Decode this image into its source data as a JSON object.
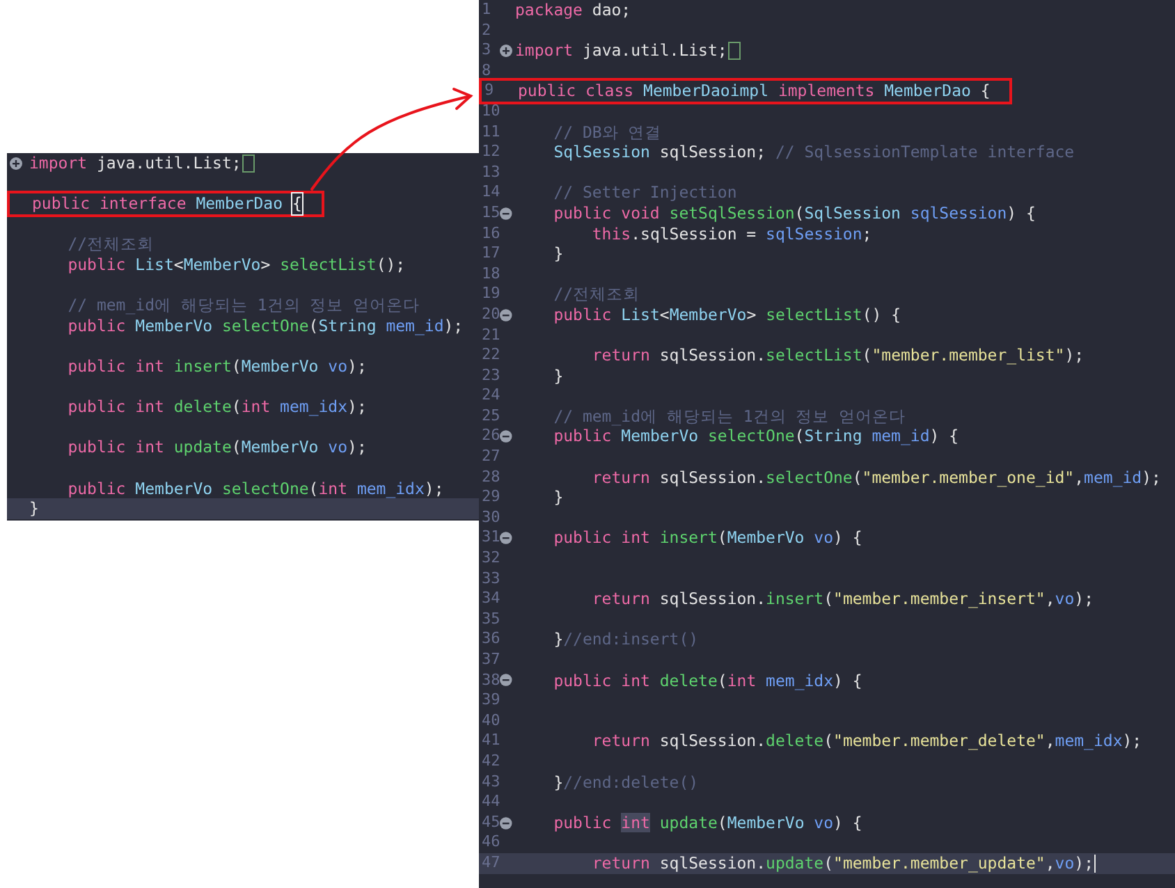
{
  "panels": [
    {
      "kind": "interface",
      "lines": [
        {
          "fold": {
            "collapsed": true
          },
          "framed": false,
          "current": false,
          "tokens": [
            {
              "kind": "keyword",
              "text": "import"
            },
            {
              "kind": "plain",
              "text": " java.util.List;"
            },
            {
              "kind": "folded"
            }
          ]
        },
        {
          "framed": false,
          "current": false
        },
        {
          "framed": true,
          "current": false,
          "tokens": [
            {
              "kind": "keyword",
              "text": "public interface "
            },
            {
              "kind": "type",
              "text": "MemberDao "
            },
            {
              "kind": "matched-bracket",
              "text": "{"
            }
          ]
        },
        {
          "framed": false,
          "current": false
        },
        {
          "framed": false,
          "current": false,
          "tokens": [
            {
              "kind": "comment",
              "text": "    //전체조회"
            }
          ]
        },
        {
          "framed": false,
          "current": false,
          "tokens": [
            {
              "kind": "keyword",
              "text": "    public "
            },
            {
              "kind": "type",
              "text": "List"
            },
            {
              "kind": "plain",
              "text": "<"
            },
            {
              "kind": "type",
              "text": "MemberVo"
            },
            {
              "kind": "plain",
              "text": "> "
            },
            {
              "kind": "method",
              "text": "selectList"
            },
            {
              "kind": "plain",
              "text": "();"
            }
          ]
        },
        {
          "framed": false,
          "current": false
        },
        {
          "framed": false,
          "current": false,
          "tokens": [
            {
              "kind": "comment",
              "text": "    // mem_id에 해당되는 1건의 정보 얻어온다"
            }
          ]
        },
        {
          "framed": false,
          "current": false,
          "tokens": [
            {
              "kind": "keyword",
              "text": "    public "
            },
            {
              "kind": "type",
              "text": "MemberVo "
            },
            {
              "kind": "method",
              "text": "selectOne"
            },
            {
              "kind": "plain",
              "text": "("
            },
            {
              "kind": "type",
              "text": "String "
            },
            {
              "kind": "variable",
              "text": "mem_id"
            },
            {
              "kind": "plain",
              "text": ");"
            }
          ]
        },
        {
          "framed": false,
          "current": false
        },
        {
          "framed": false,
          "current": false,
          "tokens": [
            {
              "kind": "keyword",
              "text": "    public int "
            },
            {
              "kind": "method",
              "text": "insert"
            },
            {
              "kind": "plain",
              "text": "("
            },
            {
              "kind": "type",
              "text": "MemberVo "
            },
            {
              "kind": "variable",
              "text": "vo"
            },
            {
              "kind": "plain",
              "text": ");"
            }
          ]
        },
        {
          "framed": false,
          "current": false
        },
        {
          "framed": false,
          "current": false,
          "tokens": [
            {
              "kind": "keyword",
              "text": "    public int "
            },
            {
              "kind": "method",
              "text": "delete"
            },
            {
              "kind": "plain",
              "text": "("
            },
            {
              "kind": "keyword",
              "text": "int "
            },
            {
              "kind": "variable",
              "text": "mem_idx"
            },
            {
              "kind": "plain",
              "text": ");"
            }
          ]
        },
        {
          "framed": false,
          "current": false
        },
        {
          "framed": false,
          "current": false,
          "tokens": [
            {
              "kind": "keyword",
              "text": "    public int "
            },
            {
              "kind": "method",
              "text": "update"
            },
            {
              "kind": "plain",
              "text": "("
            },
            {
              "kind": "type",
              "text": "MemberVo "
            },
            {
              "kind": "variable",
              "text": "vo"
            },
            {
              "kind": "plain",
              "text": ");"
            }
          ]
        },
        {
          "framed": false,
          "current": false
        },
        {
          "framed": false,
          "current": false,
          "tokens": [
            {
              "kind": "keyword",
              "text": "    public "
            },
            {
              "kind": "type",
              "text": "MemberVo "
            },
            {
              "kind": "method",
              "text": "selectOne"
            },
            {
              "kind": "plain",
              "text": "("
            },
            {
              "kind": "keyword",
              "text": "int "
            },
            {
              "kind": "variable",
              "text": "mem_idx"
            },
            {
              "kind": "plain",
              "text": ");"
            }
          ]
        },
        {
          "framed": false,
          "current": true,
          "tokens": [
            {
              "kind": "plain",
              "text": "}"
            }
          ]
        }
      ]
    },
    {
      "kind": "class",
      "lines": [
        {
          "number": "1",
          "framed": false,
          "current": false,
          "tokens": [
            {
              "kind": "keyword",
              "text": "package"
            },
            {
              "kind": "plain",
              "text": " dao;"
            }
          ]
        },
        {
          "number": "2",
          "framed": false,
          "current": false
        },
        {
          "number": "3",
          "fold": {
            "collapsed": true
          },
          "framed": false,
          "current": false,
          "tokens": [
            {
              "kind": "keyword",
              "text": "import"
            },
            {
              "kind": "plain",
              "text": " java.util.List;"
            },
            {
              "kind": "folded"
            }
          ]
        },
        {
          "number": "8",
          "framed": false,
          "current": false
        },
        {
          "number": "9",
          "framed": true,
          "current": false,
          "tokens": [
            {
              "kind": "keyword",
              "text": "public class "
            },
            {
              "kind": "type",
              "text": "MemberDaoimpl "
            },
            {
              "kind": "keyword",
              "text": "implements "
            },
            {
              "kind": "type",
              "text": "MemberDao"
            },
            {
              "kind": "plain",
              "text": " {"
            }
          ]
        },
        {
          "number": "10",
          "framed": false,
          "current": false
        },
        {
          "number": "11",
          "framed": false,
          "current": false,
          "tokens": [
            {
              "kind": "comment",
              "text": "    // DB와 연결"
            }
          ]
        },
        {
          "number": "12",
          "framed": false,
          "current": false,
          "tokens": [
            {
              "kind": "type",
              "text": "    SqlSession"
            },
            {
              "kind": "plain",
              "text": " sqlSession; "
            },
            {
              "kind": "comment",
              "text": "// SqlsessionTemplate interface"
            }
          ]
        },
        {
          "number": "13",
          "framed": false,
          "current": false
        },
        {
          "number": "14",
          "framed": false,
          "current": false,
          "tokens": [
            {
              "kind": "comment",
              "text": "    // Setter Injection"
            }
          ]
        },
        {
          "number": "15",
          "fold": {
            "collapsed": false
          },
          "framed": false,
          "current": false,
          "tokens": [
            {
              "kind": "keyword",
              "text": "    public void "
            },
            {
              "kind": "method",
              "text": "setSqlSession"
            },
            {
              "kind": "plain",
              "text": "("
            },
            {
              "kind": "type",
              "text": "SqlSession "
            },
            {
              "kind": "variable",
              "text": "sqlSession"
            },
            {
              "kind": "plain",
              "text": ") {"
            }
          ]
        },
        {
          "number": "16",
          "framed": false,
          "current": false,
          "tokens": [
            {
              "kind": "keyword",
              "text": "        this"
            },
            {
              "kind": "plain",
              "text": ".sqlSession = "
            },
            {
              "kind": "variable",
              "text": "sqlSession"
            },
            {
              "kind": "plain",
              "text": ";"
            }
          ]
        },
        {
          "number": "17",
          "framed": false,
          "current": false,
          "tokens": [
            {
              "kind": "plain",
              "text": "    }"
            }
          ]
        },
        {
          "number": "18",
          "framed": false,
          "current": false
        },
        {
          "number": "19",
          "framed": false,
          "current": false,
          "tokens": [
            {
              "kind": "comment",
              "text": "    //전체조회"
            }
          ]
        },
        {
          "number": "20",
          "fold": {
            "collapsed": false
          },
          "framed": false,
          "current": false,
          "tokens": [
            {
              "kind": "keyword",
              "text": "    public "
            },
            {
              "kind": "type",
              "text": "List"
            },
            {
              "kind": "plain",
              "text": "<"
            },
            {
              "kind": "type",
              "text": "MemberVo"
            },
            {
              "kind": "plain",
              "text": "> "
            },
            {
              "kind": "method",
              "text": "selectList"
            },
            {
              "kind": "plain",
              "text": "() {"
            }
          ]
        },
        {
          "number": "21",
          "framed": false,
          "current": false
        },
        {
          "number": "22",
          "framed": false,
          "current": false,
          "tokens": [
            {
              "kind": "keyword",
              "text": "        return"
            },
            {
              "kind": "plain",
              "text": " sqlSession."
            },
            {
              "kind": "method",
              "text": "selectList"
            },
            {
              "kind": "plain",
              "text": "("
            },
            {
              "kind": "string",
              "text": "\"member.member_list\""
            },
            {
              "kind": "plain",
              "text": ");"
            }
          ]
        },
        {
          "number": "23",
          "framed": false,
          "current": false,
          "tokens": [
            {
              "kind": "plain",
              "text": "    }"
            }
          ]
        },
        {
          "number": "24",
          "framed": false,
          "current": false
        },
        {
          "number": "25",
          "framed": false,
          "current": false,
          "tokens": [
            {
              "kind": "comment",
              "text": "    // mem_id에 해당되는 1건의 정보 얻어온다"
            }
          ]
        },
        {
          "number": "26",
          "fold": {
            "collapsed": false
          },
          "framed": false,
          "current": false,
          "tokens": [
            {
              "kind": "keyword",
              "text": "    public "
            },
            {
              "kind": "type",
              "text": "MemberVo "
            },
            {
              "kind": "method",
              "text": "selectOne"
            },
            {
              "kind": "plain",
              "text": "("
            },
            {
              "kind": "type",
              "text": "String "
            },
            {
              "kind": "variable",
              "text": "mem_id"
            },
            {
              "kind": "plain",
              "text": ") {"
            }
          ]
        },
        {
          "number": "27",
          "framed": false,
          "current": false
        },
        {
          "number": "28",
          "framed": false,
          "current": false,
          "tokens": [
            {
              "kind": "keyword",
              "text": "        return"
            },
            {
              "kind": "plain",
              "text": " sqlSession."
            },
            {
              "kind": "method",
              "text": "selectOne"
            },
            {
              "kind": "plain",
              "text": "("
            },
            {
              "kind": "string",
              "text": "\"member.member_one_id\""
            },
            {
              "kind": "plain",
              "text": ","
            },
            {
              "kind": "variable",
              "text": "mem_id"
            },
            {
              "kind": "plain",
              "text": ");"
            }
          ]
        },
        {
          "number": "29",
          "framed": false,
          "current": false,
          "tokens": [
            {
              "kind": "plain",
              "text": "    }"
            }
          ]
        },
        {
          "number": "30",
          "framed": false,
          "current": false
        },
        {
          "number": "31",
          "fold": {
            "collapsed": false
          },
          "framed": false,
          "current": false,
          "tokens": [
            {
              "kind": "keyword",
              "text": "    public int "
            },
            {
              "kind": "method",
              "text": "insert"
            },
            {
              "kind": "plain",
              "text": "("
            },
            {
              "kind": "type",
              "text": "MemberVo "
            },
            {
              "kind": "variable",
              "text": "vo"
            },
            {
              "kind": "plain",
              "text": ") {"
            }
          ]
        },
        {
          "number": "32",
          "framed": false,
          "current": false
        },
        {
          "number": "33",
          "framed": false,
          "current": false
        },
        {
          "number": "34",
          "framed": false,
          "current": false,
          "tokens": [
            {
              "kind": "keyword",
              "text": "        return"
            },
            {
              "kind": "plain",
              "text": " sqlSession."
            },
            {
              "kind": "method",
              "text": "insert"
            },
            {
              "kind": "plain",
              "text": "("
            },
            {
              "kind": "string",
              "text": "\"member.member_insert\""
            },
            {
              "kind": "plain",
              "text": ","
            },
            {
              "kind": "variable",
              "text": "vo"
            },
            {
              "kind": "plain",
              "text": ");"
            }
          ]
        },
        {
          "number": "35",
          "framed": false,
          "current": false
        },
        {
          "number": "36",
          "framed": false,
          "current": false,
          "tokens": [
            {
              "kind": "plain",
              "text": "    }"
            },
            {
              "kind": "comment",
              "text": "//end:insert()"
            }
          ]
        },
        {
          "number": "37",
          "framed": false,
          "current": false
        },
        {
          "number": "38",
          "fold": {
            "collapsed": false
          },
          "framed": false,
          "current": false,
          "tokens": [
            {
              "kind": "keyword",
              "text": "    public int "
            },
            {
              "kind": "method",
              "text": "delete"
            },
            {
              "kind": "plain",
              "text": "("
            },
            {
              "kind": "keyword",
              "text": "int "
            },
            {
              "kind": "variable",
              "text": "mem_idx"
            },
            {
              "kind": "plain",
              "text": ") {"
            }
          ]
        },
        {
          "number": "39",
          "framed": false,
          "current": false
        },
        {
          "number": "40",
          "framed": false,
          "current": false
        },
        {
          "number": "41",
          "framed": false,
          "current": false,
          "tokens": [
            {
              "kind": "keyword",
              "text": "        return"
            },
            {
              "kind": "plain",
              "text": " sqlSession."
            },
            {
              "kind": "method",
              "text": "delete"
            },
            {
              "kind": "plain",
              "text": "("
            },
            {
              "kind": "string",
              "text": "\"member.member_delete\""
            },
            {
              "kind": "plain",
              "text": ","
            },
            {
              "kind": "variable",
              "text": "mem_idx"
            },
            {
              "kind": "plain",
              "text": ");"
            }
          ]
        },
        {
          "number": "42",
          "framed": false,
          "current": false
        },
        {
          "number": "43",
          "framed": false,
          "current": false,
          "tokens": [
            {
              "kind": "plain",
              "text": "    }"
            },
            {
              "kind": "comment",
              "text": "//end:delete()"
            }
          ]
        },
        {
          "number": "44",
          "framed": false,
          "current": false
        },
        {
          "number": "45",
          "fold": {
            "collapsed": false
          },
          "framed": false,
          "current": false,
          "tokens": [
            {
              "kind": "keyword",
              "text": "    public "
            },
            {
              "kind": "occurrence",
              "text": "int"
            },
            {
              "kind": "method",
              "text": " update"
            },
            {
              "kind": "plain",
              "text": "("
            },
            {
              "kind": "type",
              "text": "MemberVo "
            },
            {
              "kind": "variable",
              "text": "vo"
            },
            {
              "kind": "plain",
              "text": ") {"
            }
          ]
        },
        {
          "number": "46",
          "framed": false,
          "current": false
        },
        {
          "number": "47",
          "framed": false,
          "current": true,
          "tokens": [
            {
              "kind": "keyword",
              "text": "        return"
            },
            {
              "kind": "plain",
              "text": " sqlSession."
            },
            {
              "kind": "method",
              "text": "update"
            },
            {
              "kind": "plain",
              "text": "("
            },
            {
              "kind": "string",
              "text": "\"member.member_update\""
            },
            {
              "kind": "plain",
              "text": ","
            },
            {
              "kind": "variable",
              "text": "vo"
            },
            {
              "kind": "plain",
              "text": ");"
            },
            {
              "kind": "caret"
            }
          ]
        }
      ]
    }
  ]
}
